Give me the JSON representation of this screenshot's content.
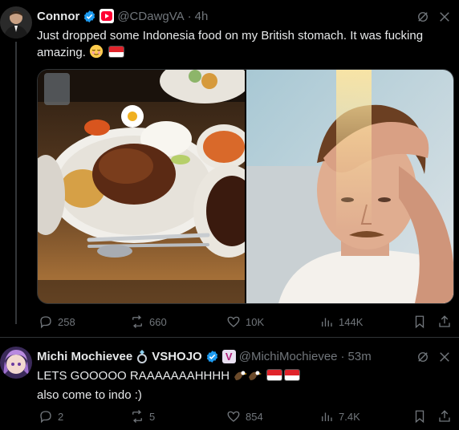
{
  "tweet1": {
    "display_name": "Connor",
    "handle": "@CDawgVA",
    "sep": "·",
    "time": "4h",
    "text_line1": "Just dropped some Indonesia food on my British stomach. It was fucking",
    "text_line2": "amazing.",
    "actions": {
      "replies": "258",
      "reposts": "660",
      "likes": "10K",
      "views": "144K"
    }
  },
  "tweet2": {
    "display_name": "Michi Mochievee",
    "affiliation": "VSHOJO",
    "handle": "@MichiMochievee",
    "sep": "·",
    "time": "53m",
    "text_line1": "LETS GOOOOO RAAAAAAAHHHH",
    "text_line2": "also come to indo :)",
    "actions": {
      "replies": "2",
      "reposts": "5",
      "likes": "854",
      "views": "7.4K"
    }
  },
  "colors": {
    "verified": "#1d9bf0",
    "muted": "#71767b",
    "background": "#000000",
    "youtube": "#ff0033"
  },
  "icons": [
    "verified-badge-icon",
    "youtube-badge-icon",
    "grok-icon",
    "more-icon",
    "reply-icon",
    "repost-icon",
    "like-icon",
    "views-icon",
    "bookmark-icon",
    "share-icon"
  ]
}
